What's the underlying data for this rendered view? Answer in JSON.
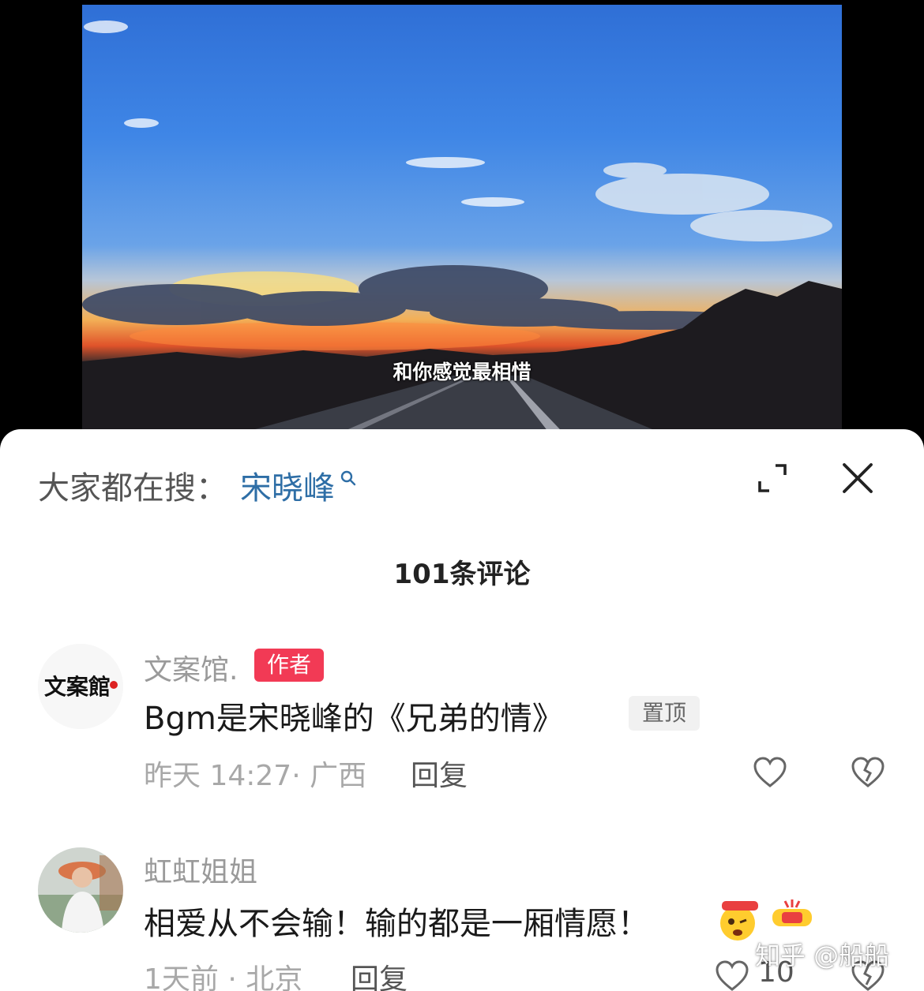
{
  "video": {
    "subtitle": "和你感觉最相惜"
  },
  "search_bar": {
    "prefix": "大家都在搜：",
    "query": "宋晓峰",
    "icon": "search-icon"
  },
  "header_icons": {
    "expand": "expand-icon",
    "close": "close-icon"
  },
  "comments_header": {
    "count_label": "101条评论"
  },
  "comments": [
    {
      "username": "文案馆.",
      "author_badge": "作者",
      "text": "Bgm是宋晓峰的《兄弟的情》",
      "pin_label": "置顶",
      "time": "昨天 14:27",
      "location": "广西",
      "meta": "昨天 14:27· 广西",
      "reply_label": "回复",
      "avatar_text": "文案館"
    },
    {
      "username": "虹虹姐姐",
      "text": "相爱从不会输！输的都是一厢情愿！",
      "time": "1天前",
      "location": "北京",
      "meta": "1天前 · 北京",
      "reply_label": "回复",
      "like_count": "10"
    }
  ],
  "watermark": "知乎 @船船",
  "colors": {
    "author_badge": "#f23a55",
    "search_link": "#2e6ea6",
    "pin_badge_bg": "#f1f1f1"
  }
}
